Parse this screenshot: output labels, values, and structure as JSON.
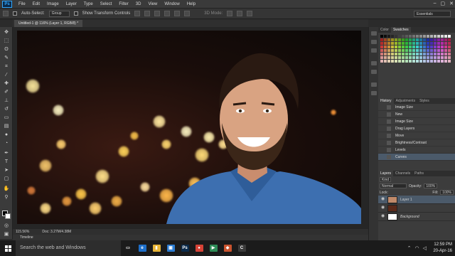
{
  "app": {
    "logo": "Ps"
  },
  "menu": [
    "File",
    "Edit",
    "Image",
    "Layer",
    "Type",
    "Select",
    "Filter",
    "3D",
    "View",
    "Window",
    "Help"
  ],
  "options_bar": {
    "auto_select_label": "Auto-Select:",
    "auto_select_value": "Group",
    "transform_label": "Show Transform Controls",
    "mode_3d": "3D Mode:",
    "workspace": "Essentials"
  },
  "document": {
    "tab_title": "Untitled-1 @ 116% (Layer 1, RGB/8) *",
    "zoom": "115.56%",
    "doc_size": "Doc: 3.27M/4.38M"
  },
  "timeline_label": "Timeline",
  "panels": {
    "color_tabs": [
      "Color",
      "Swatches"
    ],
    "history_tabs": [
      "History",
      "Adjustments",
      "Styles"
    ],
    "history_items": [
      "Image Size",
      "New",
      "Image Size",
      "Drag Layers",
      "Move",
      "Brightness/Contrast",
      "Levels",
      "Curves"
    ],
    "history_selected": 7,
    "layers_tabs": [
      "Layers",
      "Channels",
      "Paths"
    ],
    "kind_label": "Kind",
    "blend_mode": "Normal",
    "opacity_label": "Opacity:",
    "opacity_value": "100%",
    "lock_label": "Lock:",
    "fill_label": "Fill:",
    "fill_value": "100%",
    "layers": [
      {
        "name": "Layer 1",
        "selected": true
      },
      {
        "name": "",
        "selected": false
      },
      {
        "name": "Background",
        "selected": false
      }
    ]
  },
  "taskbar": {
    "search_placeholder": "Search the web and Windows",
    "apps": [
      {
        "icon": "task-view-icon",
        "label": "▭",
        "color": "#1b1b1b"
      },
      {
        "icon": "edge-icon",
        "label": "e",
        "color": "#1e6fc9"
      },
      {
        "icon": "file-explorer-icon",
        "label": "▮",
        "color": "#e8b537"
      },
      {
        "icon": "store-icon",
        "label": "▣",
        "color": "#2d7dd2"
      },
      {
        "icon": "photoshop-icon",
        "label": "Ps",
        "color": "#0b2a4a"
      },
      {
        "icon": "chrome-icon",
        "label": "●",
        "color": "#d64236"
      },
      {
        "icon": "media-icon",
        "label": "▶",
        "color": "#2e8b57"
      },
      {
        "icon": "app-icon",
        "label": "◆",
        "color": "#c9532e"
      },
      {
        "icon": "camtasia-icon",
        "label": "C",
        "color": "#3a3a3a"
      }
    ],
    "time": "12:59 PM",
    "date": "20-Apr-16"
  }
}
